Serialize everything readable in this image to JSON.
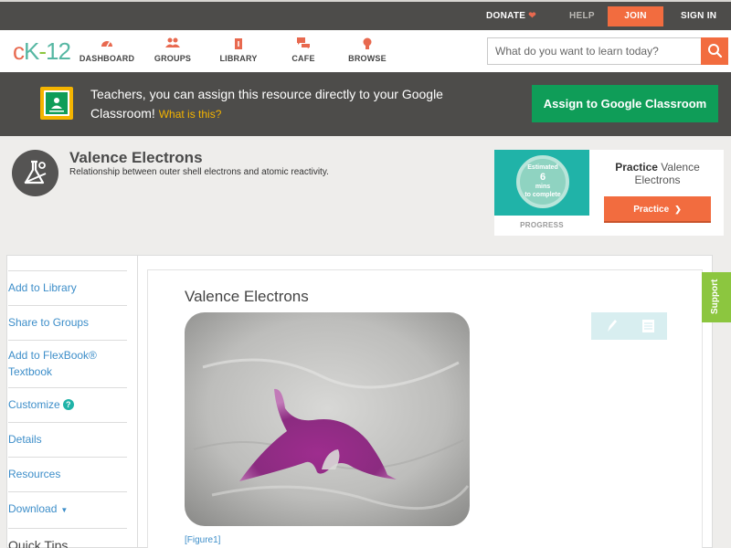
{
  "topbar": {
    "donate": "DONATE",
    "help": "HELP",
    "join": "JOIN",
    "signin": "SIGN IN"
  },
  "header": {
    "logo": {
      "c": "c",
      "k": "K",
      "dash": "-",
      "num": "12"
    },
    "nav": {
      "dashboard": "DASHBOARD",
      "groups": "GROUPS",
      "library": "LIBRARY",
      "cafe": "CAFE",
      "browse": "BROWSE"
    },
    "search_placeholder": "What do you want to learn today?"
  },
  "banner": {
    "text": "Teachers, you can assign this resource directly to your Google Classroom!",
    "what_link": "What is this?",
    "assign_button": "Assign to Google Classroom"
  },
  "concept": {
    "title": "Valence Electrons",
    "description": "Relationship between outer shell electrons and atomic reactivity."
  },
  "practice": {
    "estimated": "Estimated",
    "minutes": "6",
    "mins_label": "mins",
    "to_complete": "to complete",
    "progress_label": "PROGRESS",
    "title_bold": "Practice",
    "title_rest": "Valence Electrons",
    "button": "Practice"
  },
  "sidebar": {
    "items": [
      "Add to Library",
      "Share to Groups",
      "Add to FlexBook® Textbook",
      "Customize",
      "Details",
      "Resources",
      "Download"
    ],
    "quick_tips": "Quick Tips"
  },
  "content": {
    "title": "Valence Electrons",
    "figure_caption": "[Figure1]"
  },
  "support": "Support",
  "colors": {
    "accent_orange": "#f26c3f",
    "classroom_green": "#0f9d58",
    "link_blue": "#3d8ec9",
    "teal": "#20b3a8"
  }
}
